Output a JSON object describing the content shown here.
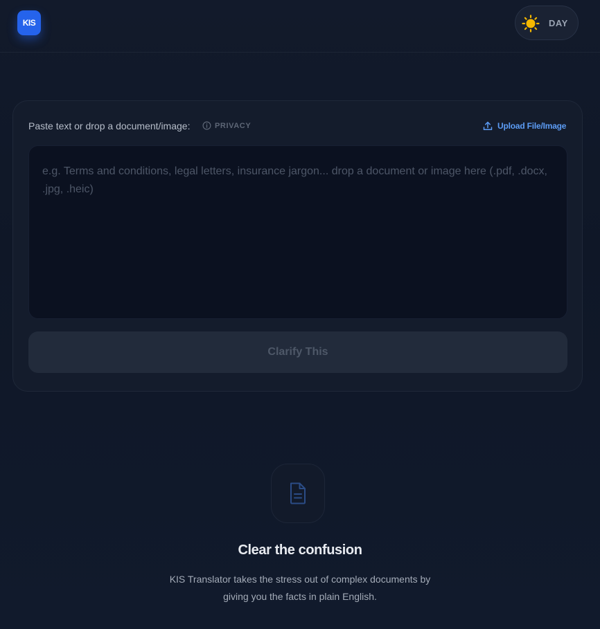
{
  "header": {
    "logo_text": "KIS",
    "theme_toggle": {
      "label": "DAY",
      "icon": "sun-icon"
    }
  },
  "input_card": {
    "label": "Paste text or drop a document/image:",
    "privacy_label": "PRIVACY",
    "upload_label": "Upload File/Image",
    "textarea_value": "",
    "textarea_placeholder": "e.g. Terms and conditions, legal letters, insurance jargon... drop a document or image here (.pdf, .docx, .jpg, .heic)",
    "submit_label": "Clarify This",
    "submit_disabled": true
  },
  "empty_state": {
    "icon": "document-icon",
    "title": "Clear the confusion",
    "description": "KIS Translator takes the stress out of complex documents by giving you the facts in plain English."
  },
  "colors": {
    "accent": "#2563eb",
    "link": "#5c9cf5",
    "sun": "#f5b800",
    "background": "#111827"
  }
}
